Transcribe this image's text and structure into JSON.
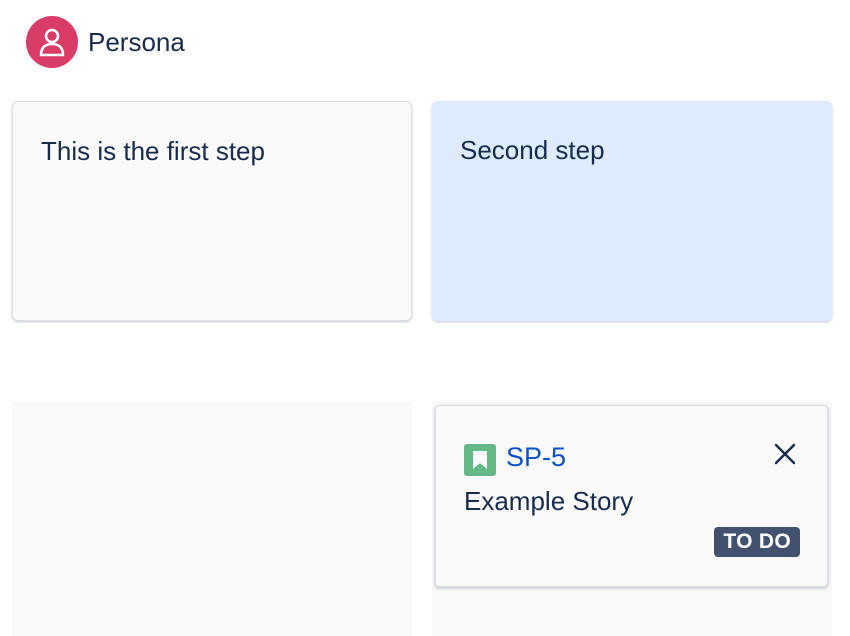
{
  "persona": {
    "label": "Persona",
    "avatar_icon": "user-icon",
    "avatar_color": "#d93d67"
  },
  "steps": [
    {
      "text": "This is the first step",
      "background": "#fafafa"
    },
    {
      "text": "Second step",
      "background": "#deebff"
    }
  ],
  "issue_card": {
    "type_icon": "story-bookmark-icon",
    "type_color": "#63ba86",
    "key": "SP-5",
    "summary": "Example Story",
    "status": "TO DO",
    "status_color": "#42526e",
    "close_icon": "close-icon"
  }
}
